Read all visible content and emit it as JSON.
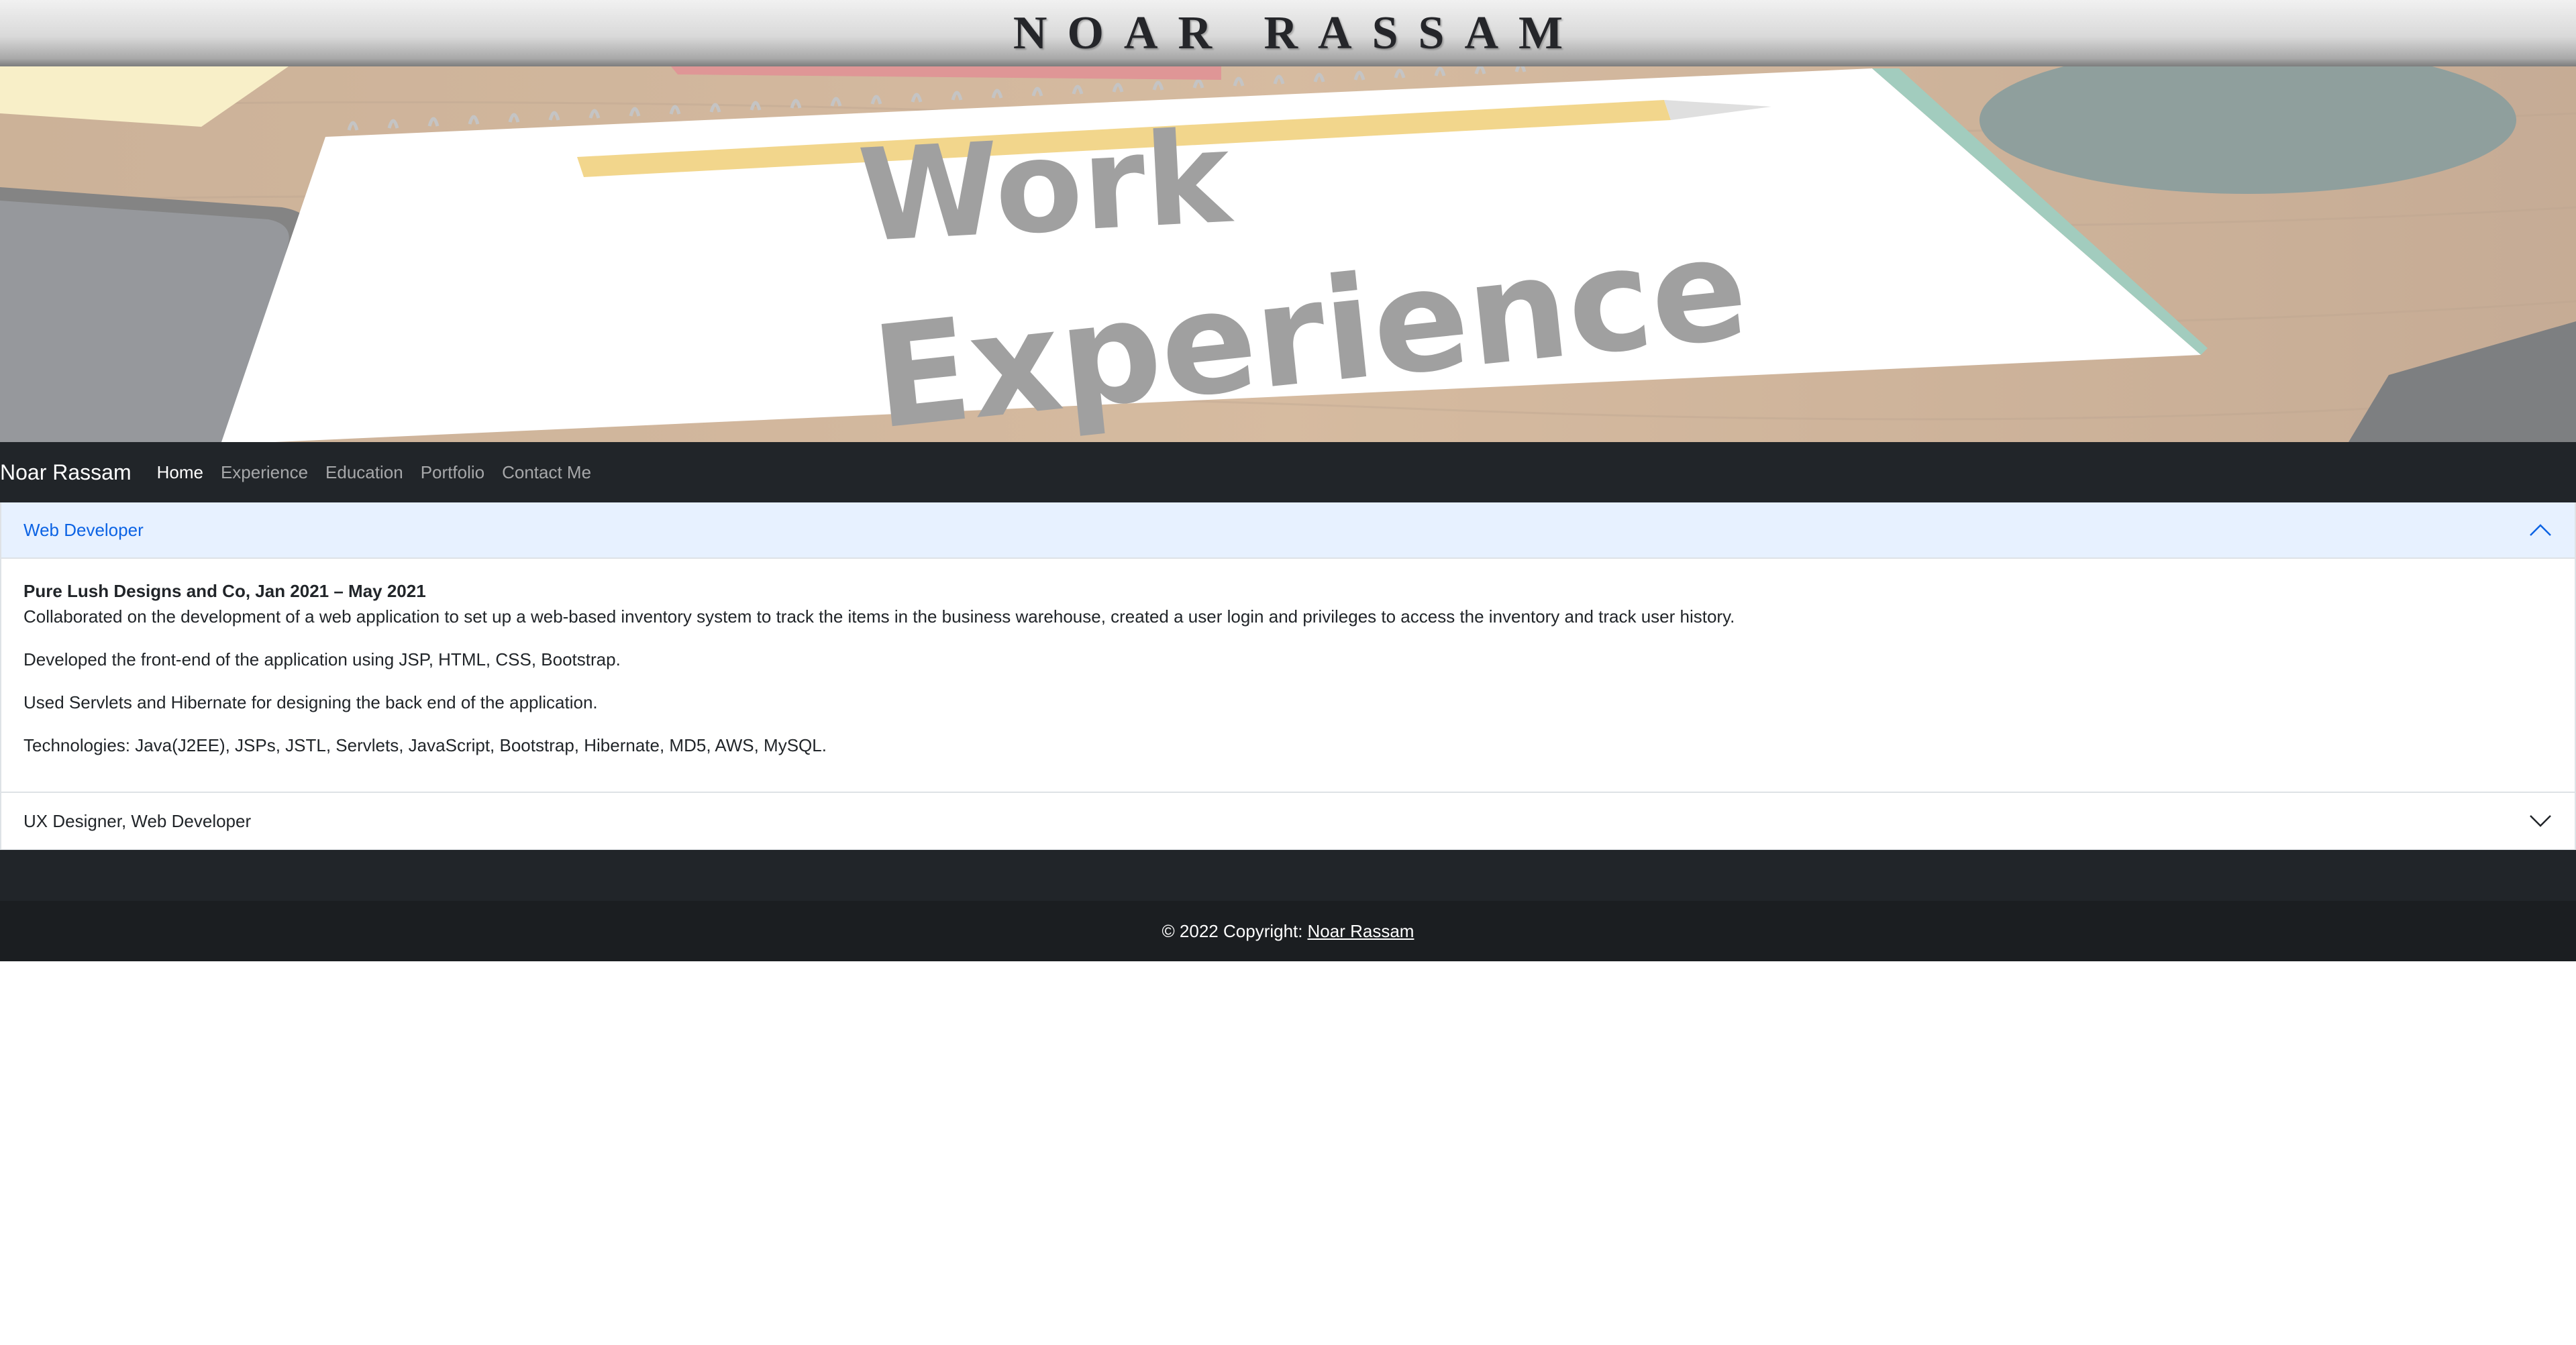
{
  "header": {
    "site_title": "NOAR RASSAM"
  },
  "hero": {
    "line1": "Work",
    "line2": "Experience"
  },
  "navbar": {
    "brand": "Noar Rassam",
    "links": [
      {
        "label": "Home",
        "active": true
      },
      {
        "label": "Experience"
      },
      {
        "label": "Education"
      },
      {
        "label": "Portfolio"
      },
      {
        "label": "Contact Me"
      }
    ]
  },
  "accordion": {
    "items": [
      {
        "title": "Web Developer",
        "expanded": true,
        "icon": "chevron-up-icon",
        "body": {
          "heading": "Pure Lush Designs and Co, Jan 2021 – May 2021",
          "paragraphs": [
            "Collaborated on the development of a web application to set up a web-based inventory system to track the items in the business warehouse, created a user login and privileges to access the inventory and track user history.",
            "Developed the front-end of the application using JSP, HTML, CSS, Bootstrap.",
            "Used Servlets and Hibernate for designing the back end of the application.",
            "Technologies: Java(J2EE), JSPs, JSTL, Servlets, JavaScript, Bootstrap, Hibernate, MD5, AWS, MySQL."
          ]
        }
      },
      {
        "title": "UX Designer, Web Developer",
        "expanded": false,
        "icon": "chevron-down-icon"
      }
    ]
  },
  "footer": {
    "copyright": "© 2022 Copyright:",
    "link_text": "Noar Rassam"
  },
  "colors": {
    "navbar_bg": "#212529",
    "accordion_active_bg": "#e7f1ff",
    "accordion_active_text": "#0c63e4",
    "footer_bg": "#1b1e21"
  }
}
